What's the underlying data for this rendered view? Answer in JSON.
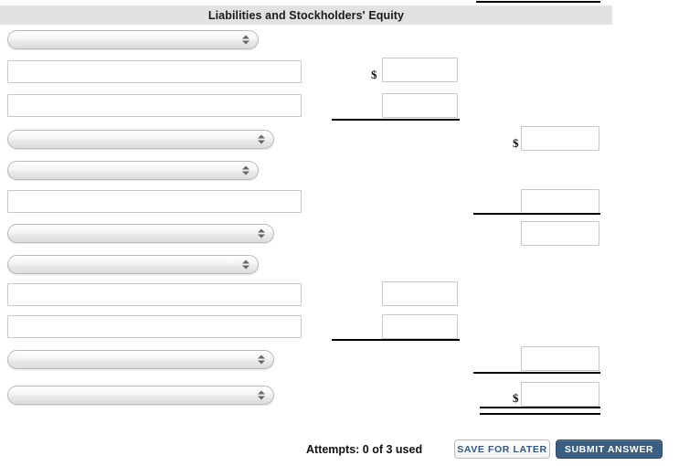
{
  "header": {
    "title": "Liabilities and Stockholders' Equity"
  },
  "currency_symbol": "$",
  "rows": [
    {
      "type": "select",
      "value": "",
      "col": "label"
    },
    {
      "type": "input",
      "value": "",
      "col": "label"
    },
    {
      "type": "input",
      "value": "",
      "col": "label"
    },
    {
      "type": "select",
      "value": "",
      "col": "label"
    },
    {
      "type": "select",
      "value": "",
      "col": "label"
    },
    {
      "type": "input",
      "value": "",
      "col": "label"
    },
    {
      "type": "select",
      "value": "",
      "col": "label"
    },
    {
      "type": "select",
      "value": "",
      "col": "label"
    },
    {
      "type": "input",
      "value": "",
      "col": "label"
    },
    {
      "type": "input",
      "value": "",
      "col": "label"
    },
    {
      "type": "select",
      "value": "",
      "col": "label"
    },
    {
      "type": "select",
      "value": "",
      "col": "label"
    }
  ],
  "amounts": {
    "middle": [
      {
        "row": 2,
        "value": ""
      },
      {
        "row": 3,
        "value": ""
      },
      {
        "row": 9,
        "value": ""
      },
      {
        "row": 10,
        "value": ""
      }
    ],
    "right": [
      {
        "row": 4,
        "value": ""
      },
      {
        "row": 6,
        "value": ""
      },
      {
        "row": 7,
        "value": ""
      },
      {
        "row": 11,
        "value": ""
      },
      {
        "row": 12,
        "value": ""
      }
    ]
  },
  "footer": {
    "attempts": "Attempts: 0 of 3 used",
    "save_label": "SAVE FOR LATER",
    "submit_label": "SUBMIT ANSWER"
  },
  "colors": {
    "header_bg": "#e2e2e2",
    "submit_bg": "#3b5f82",
    "save_text": "#2f5884",
    "rule": "#000000"
  }
}
